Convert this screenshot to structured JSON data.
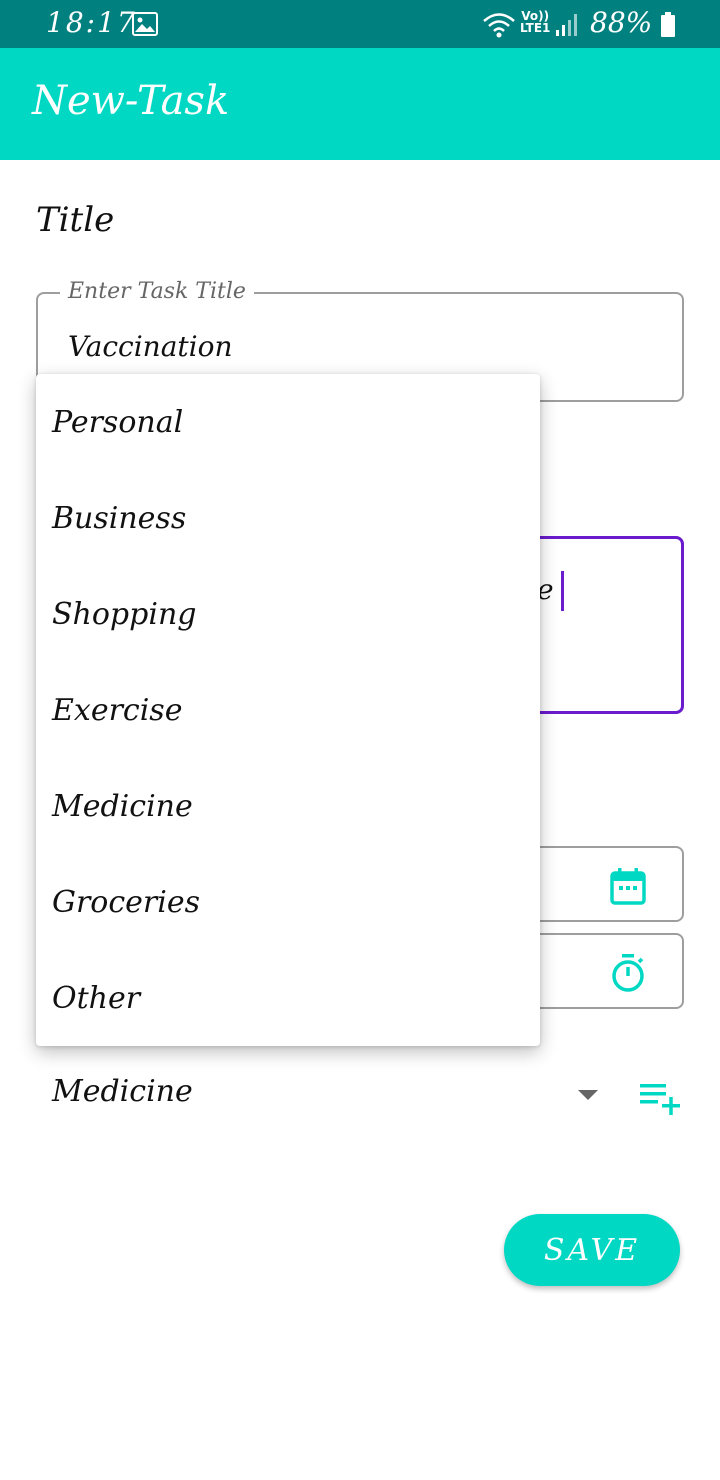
{
  "status_bar": {
    "time": "18:17",
    "volte_line1": "Vo))",
    "volte_line2": "LTE1",
    "battery": "88%"
  },
  "app_bar": {
    "title": "New-Task"
  },
  "form": {
    "section_title": "Title",
    "title_field": {
      "label": "Enter Task Title",
      "value": "Vaccination"
    },
    "description_partial": "ne",
    "category_selected": "Medicine",
    "save_label": "SAVE"
  },
  "dropdown": {
    "items": [
      "Personal",
      "Business",
      "Shopping",
      "Exercise",
      "Medicine",
      "Groceries",
      "Other"
    ]
  },
  "colors": {
    "accent": "#00d8c3",
    "status_bar": "#00807f",
    "focus": "#6a1bcd"
  },
  "icons": [
    "gallery-icon",
    "wifi-icon",
    "signal-icon",
    "battery-icon",
    "calendar-icon",
    "timer-icon",
    "playlist-add-icon",
    "dropdown-arrow-icon"
  ]
}
